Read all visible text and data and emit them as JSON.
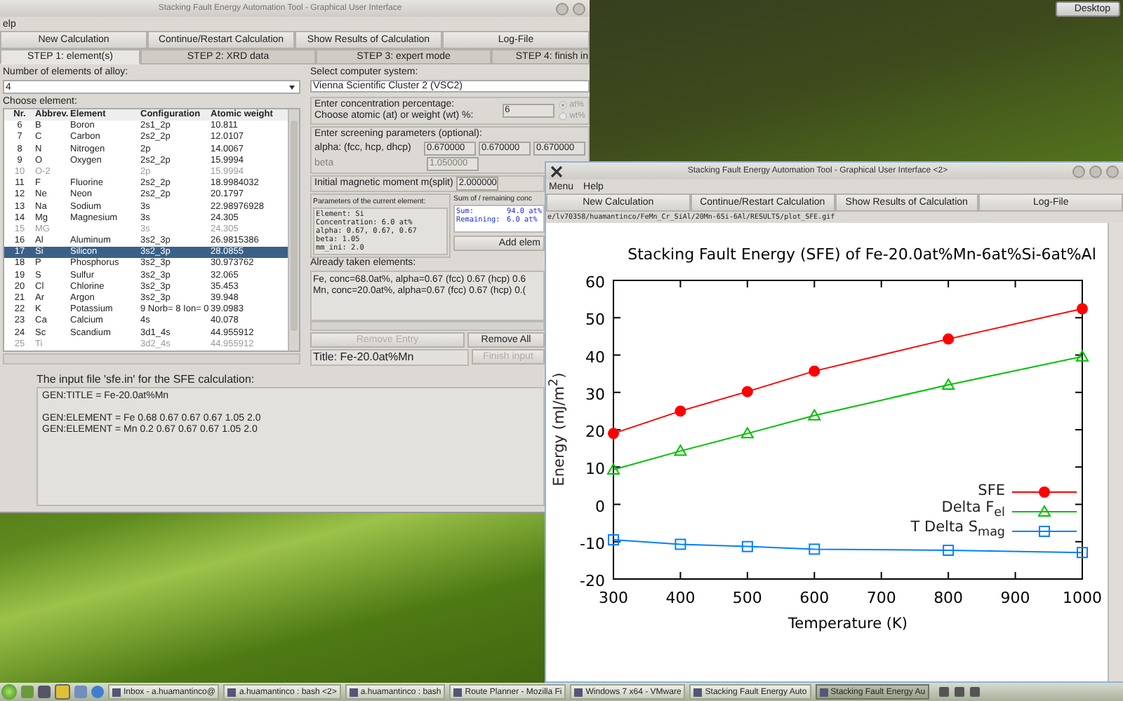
{
  "desktop_button": {
    "label": "Desktop"
  },
  "main_window": {
    "title": "Stacking Fault Energy Automation Tool - Graphical User Interface",
    "menu": [
      "elp"
    ],
    "toolbar": [
      "New Calculation",
      "Continue/Restart Calculation",
      "Show Results of Calculation",
      "Log-File"
    ],
    "tabs": [
      {
        "label": "STEP 1: element(s)",
        "selected": true
      },
      {
        "label": "STEP 2: XRD data",
        "selected": false
      },
      {
        "label": "STEP 3: expert mode",
        "selected": false
      },
      {
        "label": "STEP 4: finish in",
        "selected": false
      }
    ],
    "elements_count": {
      "label": "Number of elements of alloy:",
      "value": "4"
    },
    "choose_label": "Choose element:",
    "table": {
      "columns": [
        "Nr.",
        "Abbrev.",
        "Element",
        "Configuration",
        "Atomic weight"
      ],
      "rows": [
        {
          "nr": "6",
          "abbrev": "B",
          "element": "Boron",
          "configuration": "2s1_2p",
          "weight": "10.811",
          "selected": false,
          "disabled": false
        },
        {
          "nr": "7",
          "abbrev": "C",
          "element": "Carbon",
          "configuration": "2s2_2p",
          "weight": "12.0107",
          "selected": false,
          "disabled": false
        },
        {
          "nr": "8",
          "abbrev": "N",
          "element": "Nitrogen",
          "configuration": "2p",
          "weight": "14.0067",
          "selected": false,
          "disabled": false
        },
        {
          "nr": "9",
          "abbrev": "O",
          "element": "Oxygen",
          "configuration": "2s2_2p",
          "weight": "15.9994",
          "selected": false,
          "disabled": false
        },
        {
          "nr": "10",
          "abbrev": "O-2",
          "configuration": "2p",
          "weight": "15.9994",
          "selected": false,
          "disabled": true
        },
        {
          "nr": "11",
          "abbrev": "F",
          "element": "Fluorine",
          "configuration": "2s2_2p",
          "weight": "18.9984032",
          "selected": false,
          "disabled": false
        },
        {
          "nr": "12",
          "abbrev": "Ne",
          "element": "Neon",
          "configuration": "2s2_2p",
          "weight": "20.1797",
          "selected": false,
          "disabled": false
        },
        {
          "nr": "13",
          "abbrev": "Na",
          "element": "Sodium",
          "configuration": "3s",
          "weight": "22.98976928",
          "selected": false,
          "disabled": false
        },
        {
          "nr": "14",
          "abbrev": "Mg",
          "element": "Magnesium",
          "configuration": "3s",
          "weight": "24.305",
          "selected": false,
          "disabled": false
        },
        {
          "nr": "15",
          "abbrev": "MG",
          "configuration": "3s",
          "weight": "24.305",
          "selected": false,
          "disabled": true
        },
        {
          "nr": "16",
          "abbrev": "Al",
          "element": "Aluminum",
          "configuration": "3s2_3p",
          "weight": "26.9815386",
          "selected": false,
          "disabled": false
        },
        {
          "nr": "17",
          "abbrev": "Si",
          "element": "Silicon",
          "configuration": "3s2_3p",
          "weight": "28.0855",
          "selected": true,
          "disabled": false
        },
        {
          "nr": "18",
          "abbrev": "P",
          "element": "Phosphorus",
          "configuration": "3s2_3p",
          "weight": "30.973762",
          "selected": false,
          "disabled": false
        },
        {
          "nr": "19",
          "abbrev": "S",
          "element": "Sulfur",
          "configuration": "3s2_3p",
          "weight": "32.065",
          "selected": false,
          "disabled": false
        },
        {
          "nr": "20",
          "abbrev": "Cl",
          "element": "Chlorine",
          "configuration": "3s2_3p",
          "weight": "35.453",
          "selected": false,
          "disabled": false
        },
        {
          "nr": "21",
          "abbrev": "Ar",
          "element": "Argon",
          "configuration": "3s2_3p",
          "weight": "39.948",
          "selected": false,
          "disabled": false
        },
        {
          "nr": "22",
          "abbrev": "K",
          "element": "Potassium",
          "configuration": "9 Norb=  8 Ion=  0",
          "weight": "39.0983",
          "selected": false,
          "disabled": false
        },
        {
          "nr": "23",
          "abbrev": "Ca",
          "element": "Calcium",
          "configuration": "4s",
          "weight": "40.078",
          "selected": false,
          "disabled": false
        },
        {
          "nr": "24",
          "abbrev": "Sc",
          "element": "Scandium",
          "configuration": "3d1_4s",
          "weight": "44.955912",
          "selected": false,
          "disabled": false
        },
        {
          "nr": "25",
          "abbrev": "Ti",
          "configuration": "3d2_4s",
          "weight": "44.955912",
          "selected": false,
          "disabled": true
        }
      ]
    },
    "computer_system": {
      "label": "Select computer system:",
      "value": "Vienna Scientific Cluster 2 (VSC2)"
    },
    "concentration": {
      "label": "Enter concentration percentage:",
      "label_2": "Choose atomic (at) or weight (wt) %:",
      "value": "6",
      "units": [
        {
          "label": "at%",
          "selected": true,
          "disabled": true
        },
        {
          "label": "wt%",
          "selected": false,
          "disabled": true
        }
      ]
    },
    "screening": {
      "label": "Enter screening parameters (optional):",
      "alpha": {
        "label": "alpha: (fcc, hcp, dhcp)",
        "values": [
          "0.670000",
          "0.670000",
          "0.670000"
        ]
      },
      "beta": {
        "label": "beta",
        "value": "1.050000",
        "disabled": true
      }
    },
    "magnetic_moment": {
      "label": "Initial magnetic moment m(split)",
      "value": "2.000000"
    },
    "current_element": {
      "label": "Parameters of the current element:",
      "lines": [
        "Element: Si",
        "Concentration: 6.0 at%",
        "alpha: 0.67, 0.67, 0.67",
        "beta: 1.05",
        "mm_ini: 2.0"
      ]
    },
    "sum_box": {
      "label": "Sum of / remaining conc",
      "rows": [
        {
          "label": "Sum:",
          "value": "94.0 at%"
        },
        {
          "label": "Remaining:",
          "value": "6.0 at%"
        }
      ]
    },
    "add_button": {
      "label": "Add elem",
      "disabled": false
    },
    "taken": {
      "label": "Already taken elements:",
      "lines": [
        "Fe, conc=68.0at%, alpha=0.67 (fcc) 0.67 (hcp) 0.6",
        "Mn, conc=20.0at%, alpha=0.67 (fcc) 0.67 (hcp) 0.("
      ]
    },
    "actions": [
      {
        "label": "Remove Entry",
        "disabled": true
      },
      {
        "label": "Remove All",
        "disabled": false
      }
    ],
    "title_field": {
      "value": "Title: Fe-20.0at%Mn"
    },
    "finish_button": {
      "label": "Finish input",
      "disabled": true
    },
    "input_file": {
      "label": "The input file 'sfe.in' for the SFE calculation:",
      "lines": [
        "GEN:TITLE = Fe-20.0at%Mn",
        "GEN:ELEMENT = Fe 0.68 0.67 0.67 0.67 1.05 2.0",
        "GEN:ELEMENT = Mn 0.2 0.67 0.67 0.67 1.05 2.0"
      ]
    }
  },
  "plot_window": {
    "title": "Stacking Fault Energy Automation Tool - Graphical User Interface <2>",
    "menu": [
      "Menu",
      "Help"
    ],
    "toolbar": [
      "New Calculation",
      "Continue/Restart Calculation",
      "Show Results of Calculation",
      "Log-File"
    ],
    "path": "e/lv70358/huamantinco/FeMn_Cr_SiAl/20Mn-6Si-6Al/RESULTS/plot_SFE.gif",
    "chart_data": {
      "type": "line",
      "title": "Stacking Fault Energy (SFE) of Fe-20.0at%Mn-6at%Si-6at%Al",
      "xlabel": "Temperature (K)",
      "ylabel": "Energy (mJ/m$^{2}$)",
      "x": [
        300,
        400,
        500,
        600,
        800,
        1000
      ],
      "series": [
        {
          "name": "SFE",
          "color": "#ff0000",
          "marker": "circle",
          "values": [
            19.0,
            25.0,
            30.2,
            35.7,
            44.3,
            52.4
          ]
        },
        {
          "name": "Delta F$_{el}$",
          "color": "#00c000",
          "marker": "triangle",
          "values": [
            9.3,
            14.3,
            19.0,
            23.8,
            32.0,
            39.6
          ]
        },
        {
          "name": "T Delta S$_{mag}$",
          "color": "#0080ff",
          "marker": "square",
          "values": [
            -9.5,
            -10.7,
            -11.3,
            -12.0,
            -12.3,
            -12.9
          ]
        }
      ],
      "legend": "lower right",
      "xlim": [
        300,
        1000
      ],
      "ylim": [
        -20,
        60
      ],
      "xticks": [
        300,
        400,
        500,
        600,
        700,
        800,
        900,
        1000
      ],
      "yticks": [
        -20,
        -10,
        0,
        10,
        20,
        30,
        40,
        50,
        60
      ]
    }
  },
  "taskbar": {
    "items": [
      {
        "label": "Inbox - a.huamantinco@",
        "selected": false
      },
      {
        "label": "a.huamantinco : bash <2>",
        "selected": false
      },
      {
        "label": "a.huamantinco : bash",
        "selected": false
      },
      {
        "label": "Route Planner - Mozilla Fi",
        "selected": false
      },
      {
        "label": "Windows 7 x64 - VMware",
        "selected": false
      },
      {
        "label": "Stacking Fault Energy Auto",
        "selected": false
      },
      {
        "label": "Stacking Fault Energy Au",
        "selected": true
      }
    ]
  }
}
